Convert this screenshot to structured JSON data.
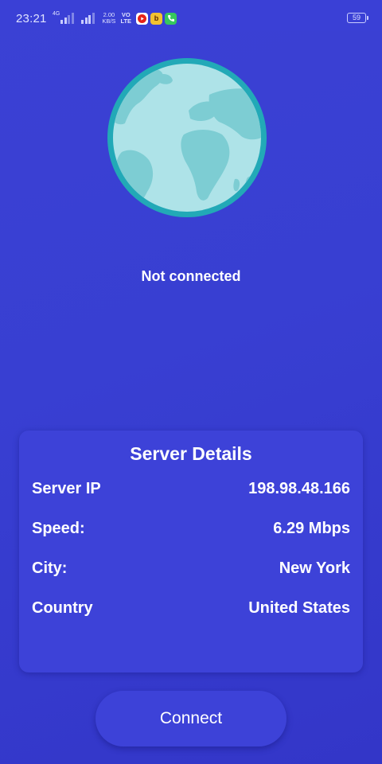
{
  "status_bar": {
    "time": "23:21",
    "network_type": "4G",
    "data_speed_value": "2.00",
    "data_speed_unit": "KB/S",
    "volte_top": "VO",
    "volte_bottom": "LTE",
    "notification_icons": [
      "youtube-icon",
      "bb-app-icon",
      "phone-call-icon"
    ],
    "battery_level": "59"
  },
  "globe": {
    "icon": "globe-icon",
    "colors": {
      "ring": "#22a9b7",
      "ocean": "#aee3e8",
      "land": "#7dcdd3"
    }
  },
  "connection": {
    "status_text": "Not connected"
  },
  "server_details": {
    "title": "Server Details",
    "rows": [
      {
        "label": "Server IP",
        "value": "198.98.48.166"
      },
      {
        "label": "Speed:",
        "value": "6.29 Mbps"
      },
      {
        "label": "City:",
        "value": "New York"
      },
      {
        "label": "Country",
        "value": "United States"
      }
    ]
  },
  "actions": {
    "connect_label": "Connect"
  },
  "theme": {
    "background": "#383fd2",
    "card": "#3d42d8",
    "text": "#ffffff"
  }
}
